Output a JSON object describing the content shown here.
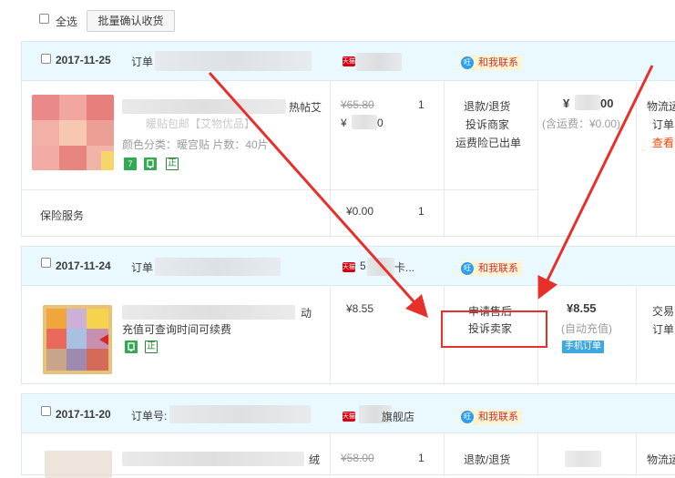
{
  "toolbar": {
    "select_all": "全选",
    "batch_confirm": "批量确认收货"
  },
  "common": {
    "contact": "和我联系",
    "contact_bubble": "旺",
    "tmall_badge": "天猫",
    "badge_7": "7",
    "badge_zheng": "正",
    "mobile_order": "手机订单"
  },
  "orders": [
    {
      "date": "2017-11-25",
      "order_label": "订单",
      "item_title": "热帖艾",
      "item_title2": "暖贴包邮【艾物优品】",
      "item_spec": "颜色分类：暖宫贴 片数：40片",
      "orig_price": "¥65.80",
      "price": "¥",
      "price_tail": "0",
      "qty": "1",
      "actions": [
        "退款/退货",
        "投诉商家",
        "运费险已出单"
      ],
      "total": "¥",
      "total_tail": "00",
      "shipping": "(含运费：¥0.00)",
      "status": [
        "物流运",
        "订单",
        "查看"
      ],
      "insurance": {
        "label": "保险服务",
        "price": "¥0.00",
        "qty": "1"
      }
    },
    {
      "date": "2017-11-24",
      "order_label": "订单",
      "shop": "5",
      "shop_tail": "卡...",
      "item_title_tail": "动",
      "item_title2": "充值可查询时间可续费",
      "price": "¥8.55",
      "qty": "",
      "actions": [
        "申请售后",
        "投诉卖家"
      ],
      "total": "¥8.55",
      "shipping": "(自动充值)",
      "status": [
        "交易",
        "订单"
      ]
    },
    {
      "date": "2017-11-20",
      "order_label": "订单号:",
      "shop_tail": "旗舰店",
      "item_title_tail": "绒",
      "orig_price": "¥58.00",
      "qty": "1",
      "actions": [
        "退款/退货"
      ],
      "status": [
        "物流运"
      ]
    }
  ]
}
